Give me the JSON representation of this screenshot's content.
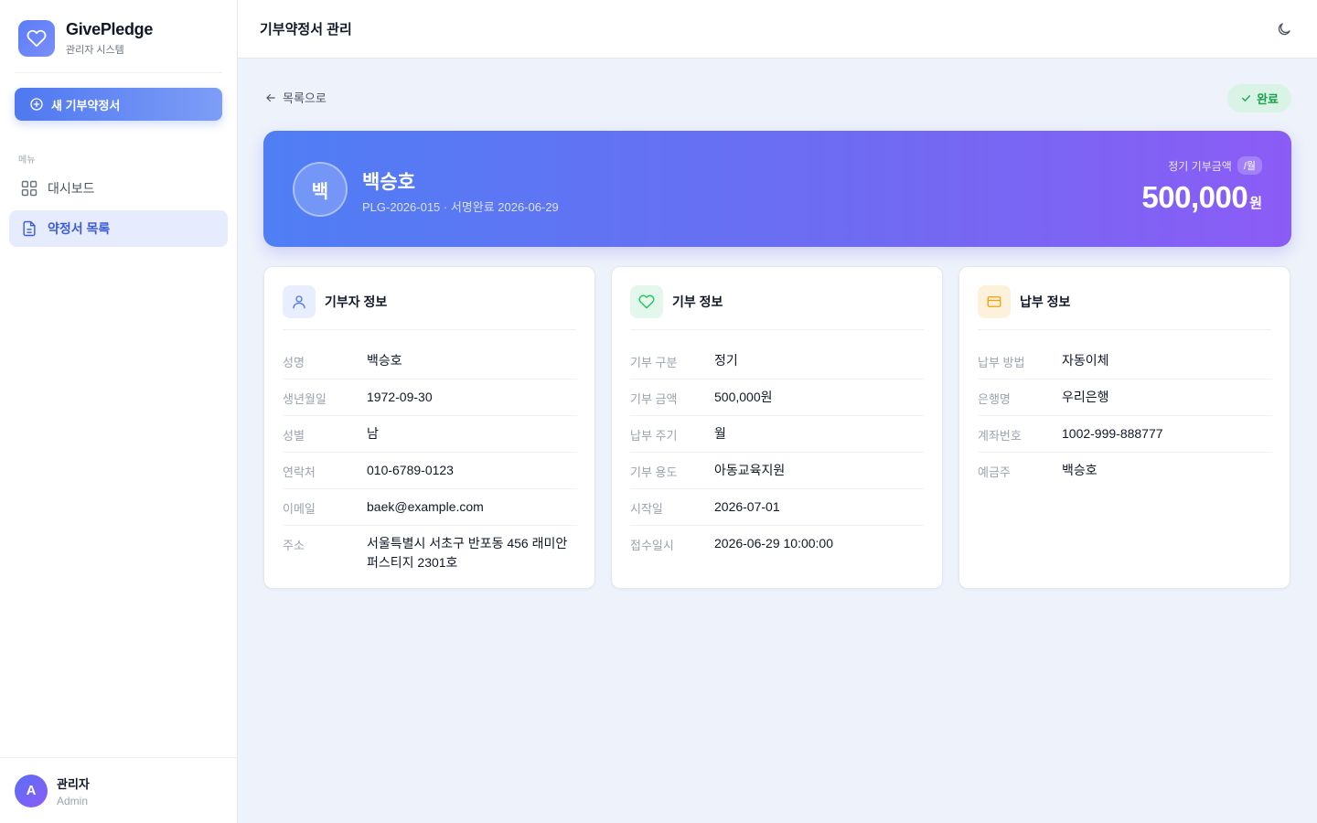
{
  "brand": {
    "name": "GivePledge",
    "subtitle": "관리자 시스템"
  },
  "sidebar": {
    "new_button": "새 기부약정서",
    "menu_label": "메뉴",
    "items": [
      {
        "label": "대시보드",
        "icon": "grid-icon",
        "active": false
      },
      {
        "label": "약정서 목록",
        "icon": "document-icon",
        "active": true
      }
    ],
    "user": {
      "initial": "A",
      "name": "관리자",
      "role": "Admin"
    }
  },
  "header": {
    "title": "기부약정서 관리",
    "theme_icon": "moon-icon"
  },
  "main": {
    "back_label": "목록으로",
    "status": "완료",
    "hero": {
      "initial": "백",
      "name": "백승호",
      "meta": "PLG-2026-015 · 서명완료 2026-06-29",
      "amount_label": "정기 기부금액",
      "period": "/월",
      "amount": "500,000",
      "unit": "원"
    },
    "cards": {
      "donor": {
        "title": "기부자 정보",
        "rows": [
          {
            "label": "성명",
            "value": "백승호"
          },
          {
            "label": "생년월일",
            "value": "1972-09-30"
          },
          {
            "label": "성별",
            "value": "남"
          },
          {
            "label": "연락처",
            "value": "010-6789-0123"
          },
          {
            "label": "이메일",
            "value": "baek@example.com"
          },
          {
            "label": "주소",
            "value": "서울특별시 서초구 반포동 456 래미안퍼스티지 2301호"
          }
        ]
      },
      "donation": {
        "title": "기부 정보",
        "rows": [
          {
            "label": "기부 구분",
            "value": "정기"
          },
          {
            "label": "기부 금액",
            "value": "500,000원"
          },
          {
            "label": "납부 주기",
            "value": "월"
          },
          {
            "label": "기부 용도",
            "value": "아동교육지원"
          },
          {
            "label": "시작일",
            "value": "2026-07-01"
          },
          {
            "label": "접수일시",
            "value": "2026-06-29 10:00:00"
          }
        ]
      },
      "payment": {
        "title": "납부 정보",
        "rows": [
          {
            "label": "납부 방법",
            "value": "자동이체"
          },
          {
            "label": "은행명",
            "value": "우리은행"
          },
          {
            "label": "계좌번호",
            "value": "1002-999-888777"
          },
          {
            "label": "예금주",
            "value": "백승호"
          }
        ]
      }
    }
  },
  "colors": {
    "primary": "#4f78f0",
    "accent_purple": "#8b5cf6",
    "success": "#16a34a",
    "donation_green": "#22c55e",
    "payment_orange": "#f59e0b"
  }
}
